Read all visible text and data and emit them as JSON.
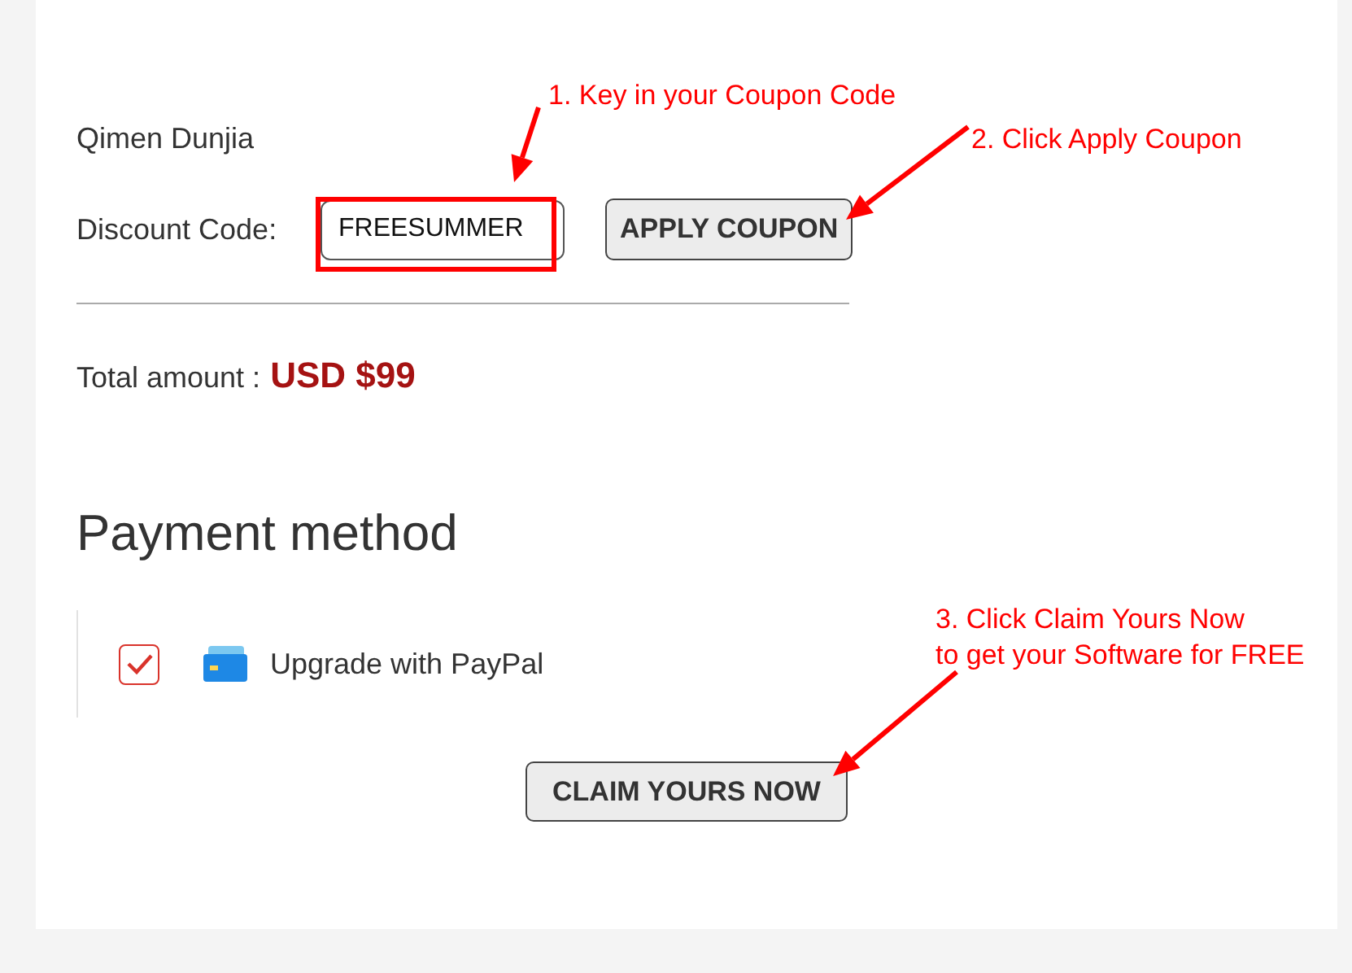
{
  "product": {
    "name": "Qimen Dunjia"
  },
  "discount": {
    "label": "Discount Code:",
    "value": "FREESUMMER",
    "button": "APPLY COUPON"
  },
  "total": {
    "label": "Total amount :",
    "amount": "USD $99"
  },
  "payment": {
    "heading": "Payment method",
    "options": [
      {
        "label": "Upgrade with PayPal",
        "checked": true
      }
    ]
  },
  "claim_button": "CLAIM YOURS NOW",
  "annotations": [
    {
      "kind": "callout",
      "text": "1. Key in your Coupon Code"
    },
    {
      "kind": "callout",
      "text": "2. Click Apply Coupon"
    },
    {
      "kind": "callout",
      "text": "3. Click Claim Yours Now\nto get your Software for FREE"
    },
    {
      "kind": "highlight"
    }
  ]
}
